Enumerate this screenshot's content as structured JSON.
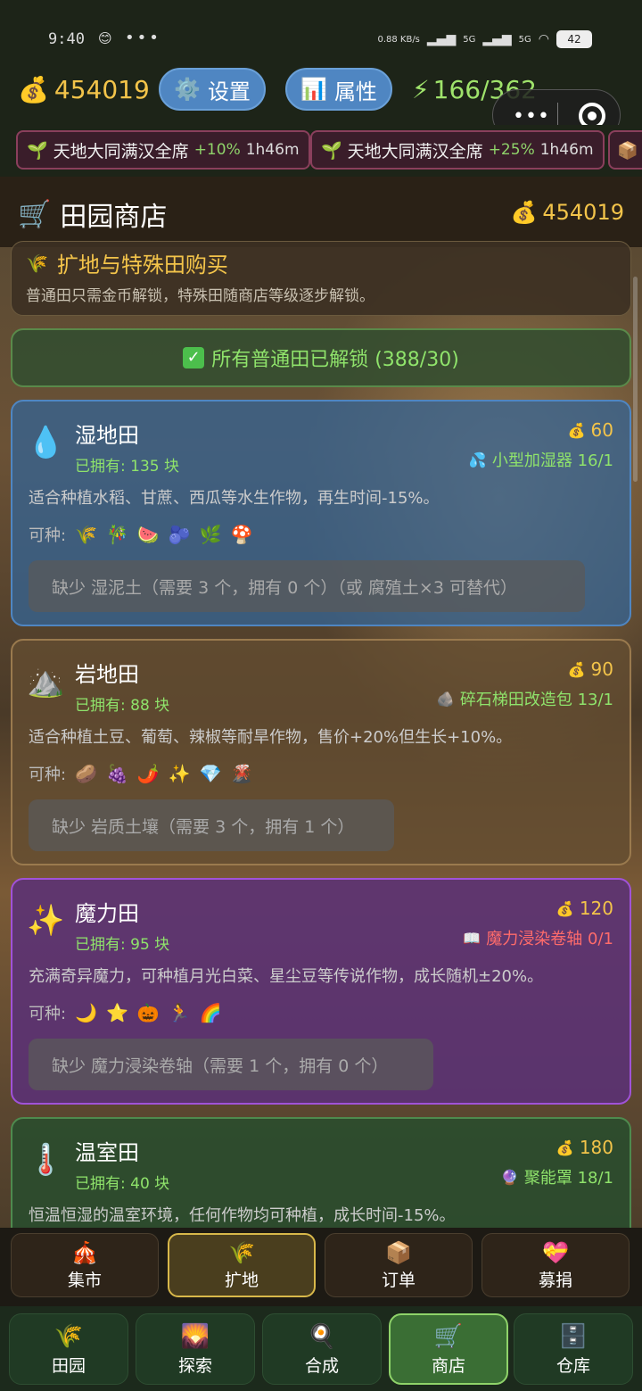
{
  "status": {
    "time": "9:40",
    "emoji": "😊",
    "dots": "•••",
    "net": "0.88 KB/s",
    "signal1": "5G",
    "signal2": "5G",
    "battery": "42"
  },
  "top": {
    "coins": "454019",
    "settings_label": "设置",
    "attrs_label": "属性",
    "energy": "166/362"
  },
  "buffs": [
    {
      "name": "天地大同满汉全席",
      "pct": "+10%",
      "dur": "1h46m"
    },
    {
      "name": "天地大同满汉全席",
      "pct": "+25%",
      "dur": "1h46m"
    }
  ],
  "shop": {
    "title": "田园商店",
    "coins": "454019"
  },
  "expand": {
    "title": "扩地与特殊田购买",
    "subtitle": "普通田只需金币解锁，特殊田随商店等级逐步解锁。"
  },
  "done": {
    "text": "所有普通田已解锁 (388/30)"
  },
  "fields": [
    {
      "name": "湿地田",
      "owned": "已拥有: 135 块",
      "price": "60",
      "req": "小型加湿器 16/1",
      "req_color": "#8fe36b",
      "desc": "适合种植水稻、甘蔗、西瓜等水生作物，再生时间-15%。",
      "plant_label": "可种:",
      "plants": [
        "🌾",
        "🎋",
        "🍉",
        "🫐",
        "🌿",
        "🍄"
      ],
      "missing": "缺少 湿泥土（需要 3 个，拥有 0 个）（或 腐殖土×3 可替代）"
    },
    {
      "name": "岩地田",
      "owned": "已拥有: 88 块",
      "price": "90",
      "req": "碎石梯田改造包 13/1",
      "req_color": "#8fe36b",
      "desc": "适合种植土豆、葡萄、辣椒等耐旱作物，售价+20%但生长+10%。",
      "plant_label": "可种:",
      "plants": [
        "🥔",
        "🍇",
        "🌶️",
        "✨",
        "💎",
        "🌋"
      ],
      "missing": "缺少 岩质土壤（需要 3 个，拥有 1 个）"
    },
    {
      "name": "魔力田",
      "owned": "已拥有: 95 块",
      "price": "120",
      "req": "魔力浸染卷轴 0/1",
      "req_color": "#ff6b6b",
      "desc": "充满奇异魔力，可种植月光白菜、星尘豆等传说作物，成长随机±20%。",
      "plant_label": "可种:",
      "plants": [
        "🌙",
        "⭐",
        "🎃",
        "🏃",
        "🌈"
      ],
      "missing": "缺少 魔力浸染卷轴（需要 1 个，拥有 0 个）"
    },
    {
      "name": "温室田",
      "owned": "已拥有: 40 块",
      "price": "180",
      "req": "聚能罩 18/1",
      "req_color": "#8fe36b",
      "desc": "恒温恒湿的温室环境，任何作物均可种植，成长时间-15%。"
    }
  ],
  "subnav": [
    "集市",
    "扩地",
    "订单",
    "募捐"
  ],
  "nav": [
    "田园",
    "探索",
    "合成",
    "商店",
    "仓库"
  ]
}
